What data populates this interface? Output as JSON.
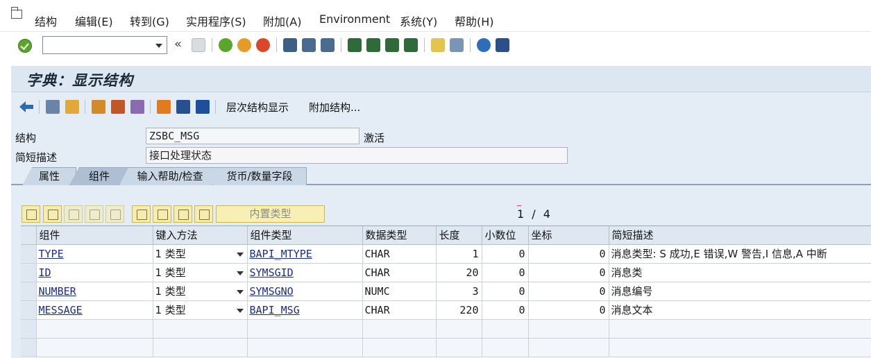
{
  "menu": {
    "items": [
      "结构",
      "编辑(E)",
      "转到(G)",
      "实用程序(S)",
      "附加(A)",
      "Environment",
      "系统(Y)",
      "帮助(H)"
    ]
  },
  "command_field": {
    "value": ""
  },
  "title": "字典：显示结构",
  "app_toolbar": {
    "hierarchy_label": "层次结构显示",
    "append_label": "附加结构..."
  },
  "header": {
    "struct_label": "结构",
    "struct_value": "ZSBC_MSG",
    "status": "激活",
    "desc_label": "简短描述",
    "desc_value": "接口处理状态"
  },
  "tabs": [
    {
      "label": "属性",
      "active": false
    },
    {
      "label": "组件",
      "active": true
    },
    {
      "label": "输入帮助/检查",
      "active": false
    },
    {
      "label": "货币/数量字段",
      "active": false
    }
  ],
  "grid_toolbar": {
    "builtin_type_label": "内置类型"
  },
  "pager": {
    "current": "1",
    "separator": "/",
    "total": "4"
  },
  "table": {
    "columns": [
      "组件",
      "键入方法",
      "组件类型",
      "数据类型",
      "长度",
      "小数位",
      "坐标",
      "简短描述"
    ],
    "rows": [
      {
        "component": "TYPE",
        "typing": "1 类型",
        "comp_type": "BAPI_MTYPE",
        "data_type": "CHAR",
        "length": "1",
        "decimals": "0",
        "coord": "0",
        "desc": "消息类型: S 成功,E 错误,W 警告,I 信息,A 中断"
      },
      {
        "component": "ID",
        "typing": "1 类型",
        "comp_type": "SYMSGID",
        "data_type": "CHAR",
        "length": "20",
        "decimals": "0",
        "coord": "0",
        "desc": "消息类"
      },
      {
        "component": "NUMBER",
        "typing": "1 类型",
        "comp_type": "SYMSGNO",
        "data_type": "NUMC",
        "length": "3",
        "decimals": "0",
        "coord": "0",
        "desc": "消息编号"
      },
      {
        "component": "MESSAGE",
        "typing": "1 类型",
        "comp_type": "BAPI_MSG",
        "data_type": "CHAR",
        "length": "220",
        "decimals": "0",
        "coord": "0",
        "desc": "消息文本"
      }
    ]
  }
}
